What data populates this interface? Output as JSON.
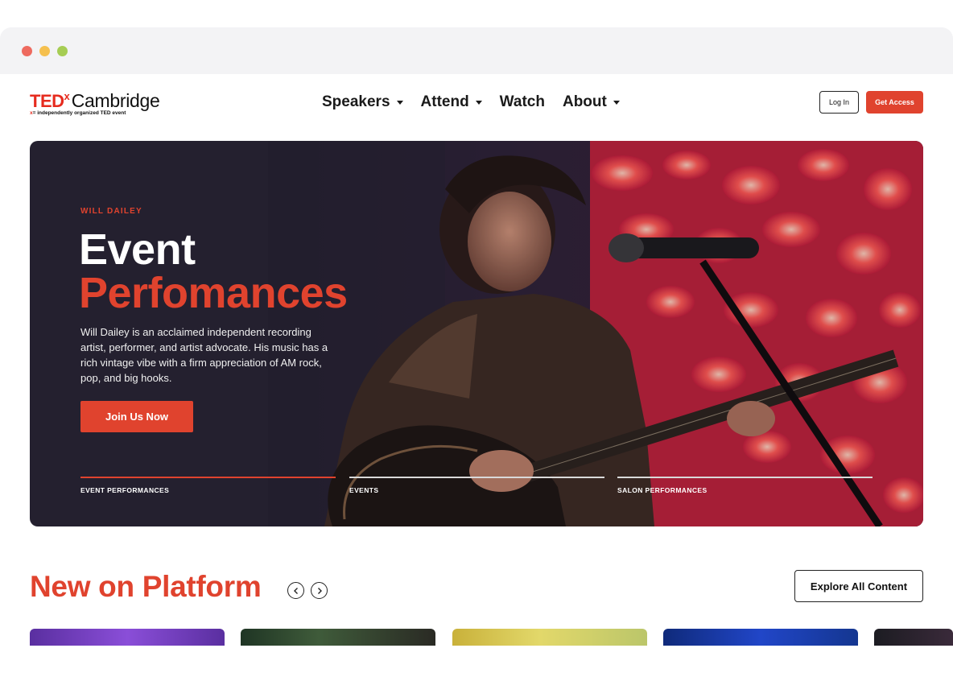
{
  "nav": {
    "logo_ted": "TED",
    "logo_x": "x",
    "logo_city": "Cambridge",
    "logo_sub_x": "x",
    "logo_sub_text": "= independently organized TED event",
    "menu": [
      {
        "label": "Speakers",
        "has_dropdown": true
      },
      {
        "label": "Attend",
        "has_dropdown": true
      },
      {
        "label": "Watch",
        "has_dropdown": false
      },
      {
        "label": "About",
        "has_dropdown": true
      }
    ],
    "login_label": "Log In",
    "access_label": "Get Access"
  },
  "hero": {
    "eyebrow": "WILL DAILEY",
    "title_line1": "Event",
    "title_line2": "Perfomances",
    "description": "Will Dailey is an acclaimed independent recording artist, performer, and artist advocate. His music has a rich vintage vibe with a firm appreciation of AM rock, pop, and big hooks.",
    "cta_label": "Join Us Now",
    "tabs": [
      {
        "label": "EVENT PERFORMANCES",
        "active": true
      },
      {
        "label": "EVENTS",
        "active": false
      },
      {
        "label": "SALON PERFORMANCES",
        "active": false
      }
    ]
  },
  "section": {
    "title": "New on Platform",
    "explore_label": "Explore All Content"
  },
  "colors": {
    "accent": "#e0432e",
    "hero_bg": "#24202f"
  },
  "icons": {
    "prev": "chevron-left-icon",
    "next": "chevron-right-icon"
  }
}
